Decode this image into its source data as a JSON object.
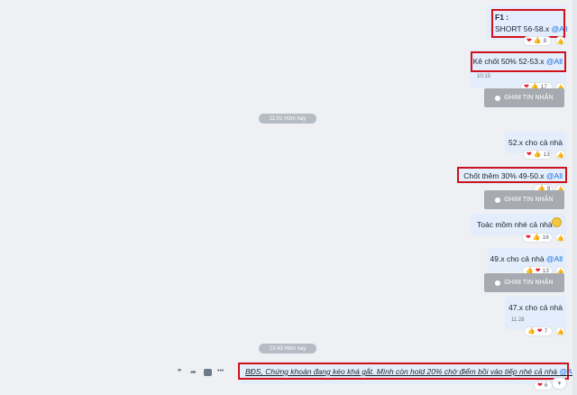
{
  "messages": [
    {
      "line1": "F1 :",
      "line2": "SHORT 56-58.x ",
      "mention": "@All",
      "react_count": "8"
    },
    {
      "text": "Kê chốt 50% 52-53.x ",
      "mention": "@All",
      "time": "10:15",
      "react_count": "17"
    },
    {
      "text": "52.x cho cả nhà",
      "react_count": "13"
    },
    {
      "text": "Chốt thêm 30% 49-50.x ",
      "mention": "@All",
      "react_count": "9"
    },
    {
      "text": "Toác mồm nhé cả nhà",
      "react_count": "16"
    },
    {
      "text": "49.x cho cả nhà ",
      "mention": "@All",
      "react_count": "13"
    },
    {
      "text": "47.x cho cả nhà",
      "time": "11:28",
      "react_count": "7"
    },
    {
      "text": "BĐS, Chứng khoán đang kéo khá gắt. Mình còn hold 20% chờ điểm bồi vào tiếp nhé cả nhà ",
      "mention": "@Al",
      "react_count": "6"
    }
  ],
  "pin_label": "GHIM TIN NHẮN",
  "dividers": [
    "11:01 Hôm nay",
    "13:43 Hôm nay"
  ],
  "toolbar": {
    "quote": "❞",
    "forward": "➦",
    "more": "•••"
  },
  "colors": {
    "bubble": "#e3edfb",
    "highlight": "#d0121b",
    "mention": "#1c6fe0",
    "pin": "#a7abb1"
  },
  "icons": [
    "heart-icon",
    "thumbs-up-icon",
    "like-outline-icon",
    "pin-icon",
    "quote-icon",
    "forward-icon",
    "more-icon",
    "chevron-down-icon"
  ]
}
